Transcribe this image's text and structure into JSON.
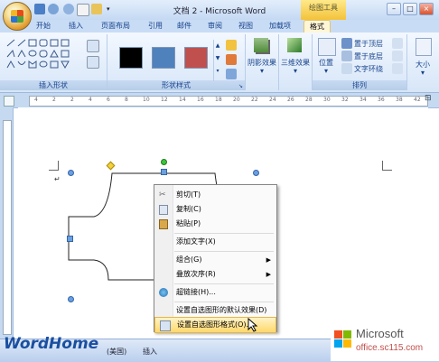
{
  "titlebar": {
    "title": "文档 2 - Microsoft Word",
    "context_tools": "绘图工具"
  },
  "tabs": [
    "开始",
    "插入",
    "页面布局",
    "引用",
    "邮件",
    "审阅",
    "视图",
    "加载项",
    "格式"
  ],
  "active_tab": "格式",
  "ribbon": {
    "group_insert_shapes": "插入形状",
    "group_shape_styles": "形状样式",
    "shadow_effects": "阴影效果",
    "effects_3d": "三维效果",
    "position": "位置",
    "bring_to_front": "置于顶层",
    "send_to_back": "置于底层",
    "text_wrapping": "文字环绕",
    "group_arrange": "排列",
    "size": "大小",
    "swatch_colors": [
      "#000000",
      "#4f81bd",
      "#c0504d"
    ]
  },
  "ruler_ticks": [
    "4",
    "2",
    "2",
    "4",
    "6",
    "8",
    "10",
    "12",
    "14",
    "16",
    "18",
    "20",
    "22",
    "24",
    "26",
    "28",
    "30",
    "32",
    "34",
    "36",
    "38",
    "42"
  ],
  "context_menu": {
    "items": [
      {
        "label": "剪切(T)",
        "icon": "scissors-icon"
      },
      {
        "label": "复制(C)",
        "icon": "copy-icon"
      },
      {
        "label": "粘贴(P)",
        "icon": "paste-icon"
      },
      {
        "label": "添加文字(X)",
        "icon": ""
      },
      {
        "label": "组合(G)",
        "icon": "",
        "submenu": true
      },
      {
        "label": "叠放次序(R)",
        "icon": "",
        "submenu": true
      },
      {
        "label": "超链接(H)...",
        "icon": "hyperlink-icon"
      },
      {
        "label": "设置自选图形的默认效果(D)",
        "icon": ""
      },
      {
        "label": "设置自选图形格式(O)...",
        "icon": "format-shape-icon",
        "highlighted": true
      }
    ]
  },
  "statusbar": {
    "watermark": "WordHome",
    "language": "(美国)",
    "mode": "插入"
  },
  "ms_logo": {
    "name": "Microsoft",
    "site": "office.sc115.com"
  }
}
